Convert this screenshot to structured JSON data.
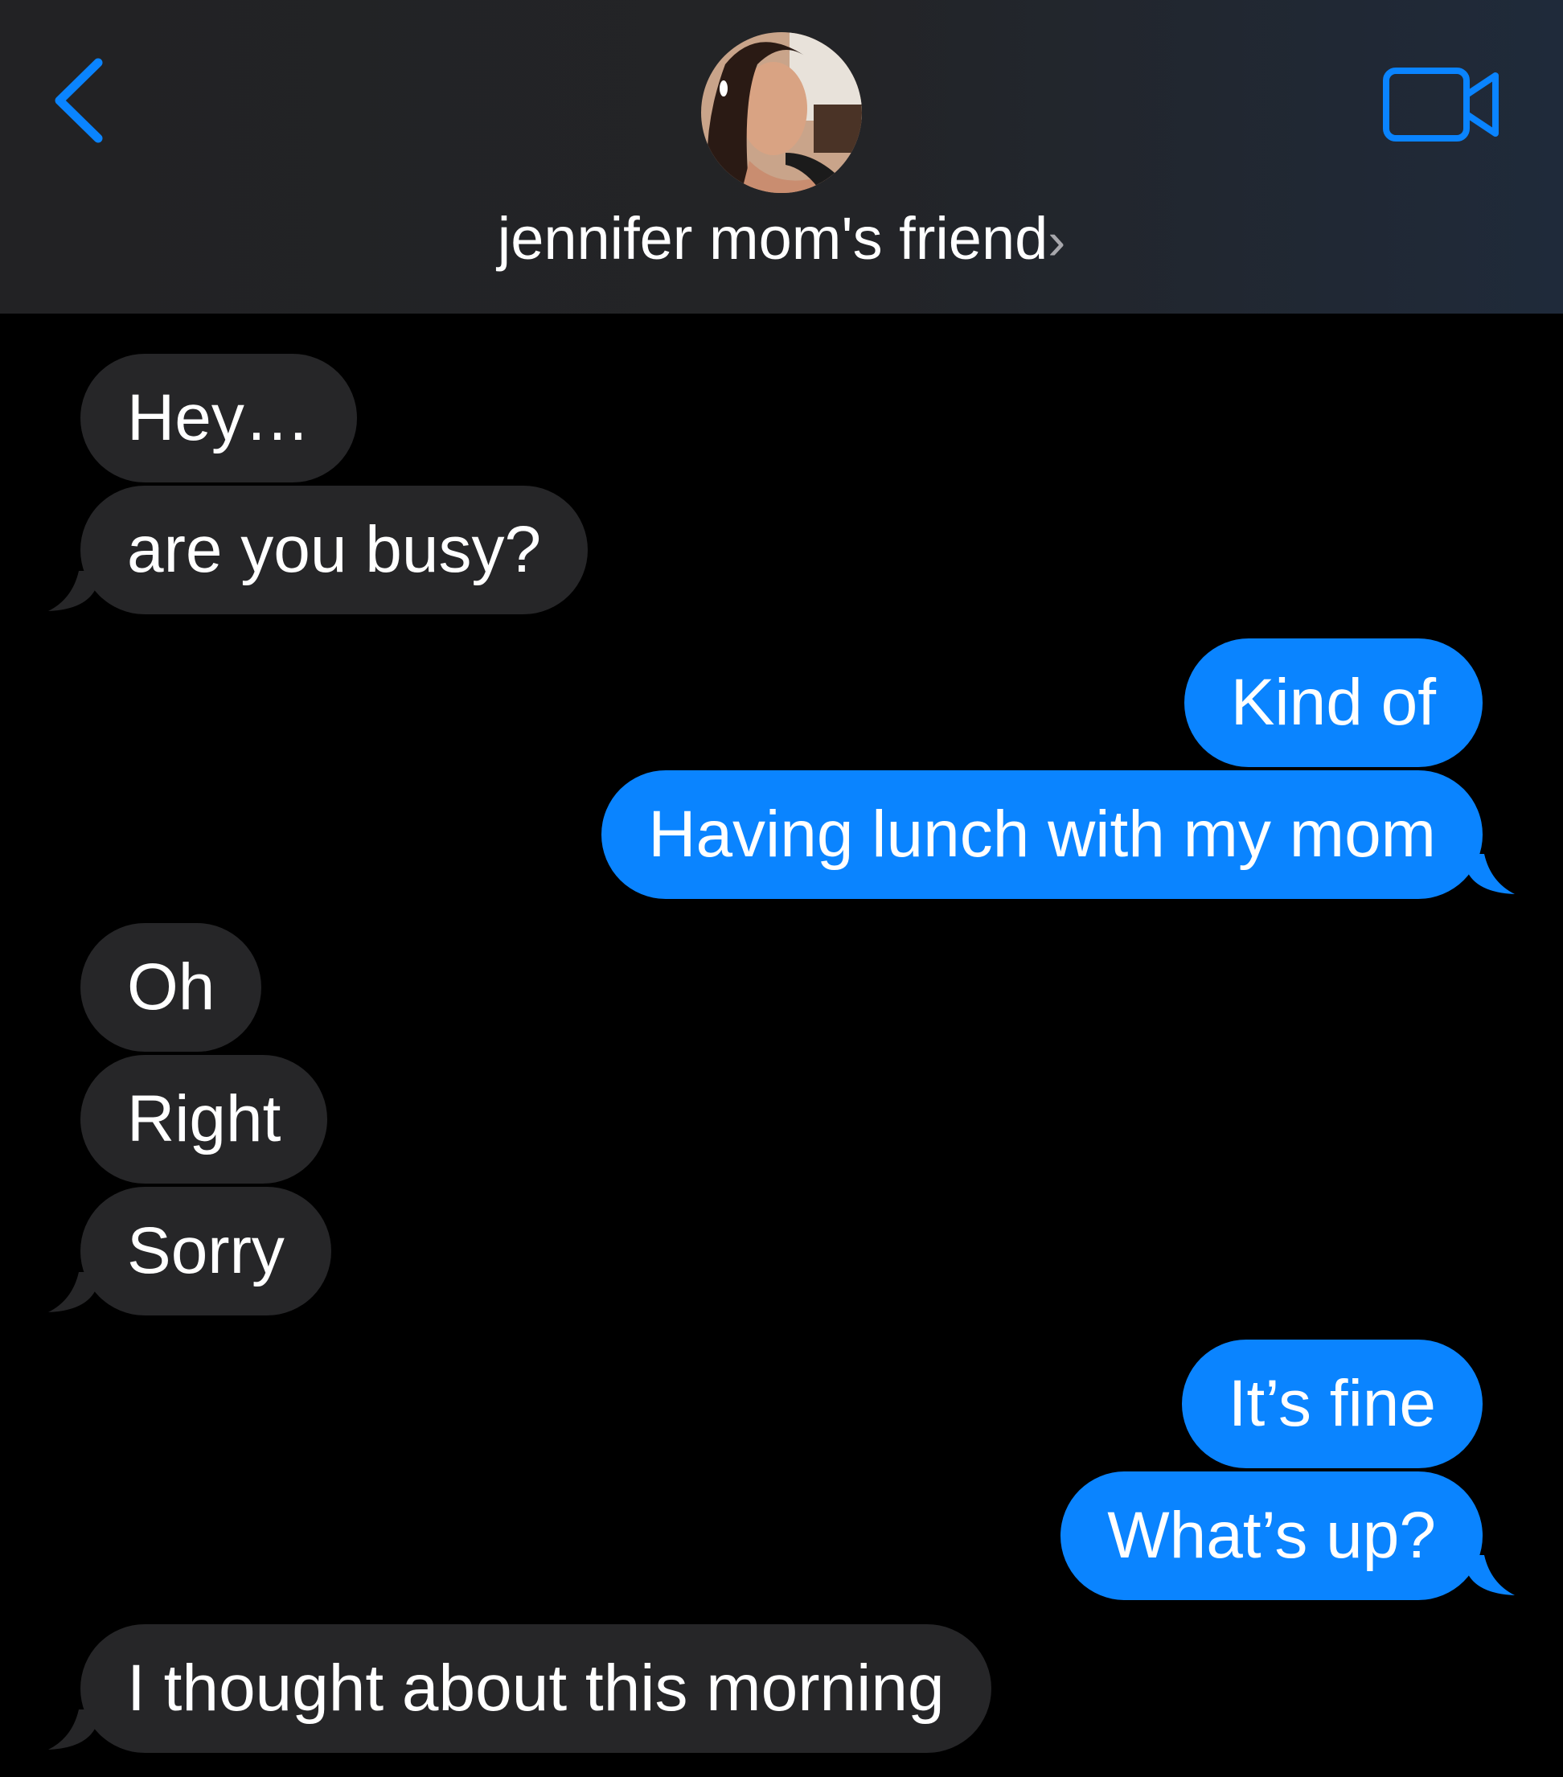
{
  "colors": {
    "incoming_bubble": "#262628",
    "outgoing_bubble": "#0a84ff",
    "accent": "#0a84ff",
    "background": "#000000"
  },
  "header": {
    "back_icon": "chevron-left-icon",
    "contact_name": "jennifer mom's friend",
    "contact_chevron": "›",
    "video_icon": "video-camera-icon"
  },
  "messages": [
    {
      "direction": "incoming",
      "text": "Hey…"
    },
    {
      "direction": "incoming",
      "text": "are you busy?"
    },
    {
      "direction": "outgoing",
      "text": "Kind of"
    },
    {
      "direction": "outgoing",
      "text": "Having lunch with my mom"
    },
    {
      "direction": "incoming",
      "text": "Oh"
    },
    {
      "direction": "incoming",
      "text": "Right"
    },
    {
      "direction": "incoming",
      "text": "Sorry"
    },
    {
      "direction": "outgoing",
      "text": "It’s fine"
    },
    {
      "direction": "outgoing",
      "text": "What’s up?"
    },
    {
      "direction": "incoming",
      "text": "I thought about this morning"
    }
  ]
}
